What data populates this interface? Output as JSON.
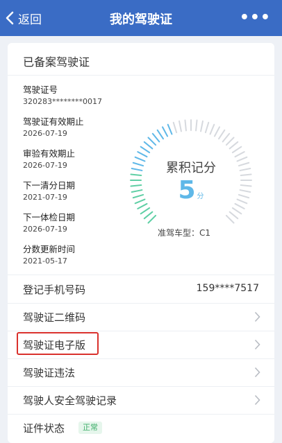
{
  "nav": {
    "back_label": "返回",
    "title": "我的驾驶证",
    "more_label": "•••"
  },
  "card": {
    "title": "已备案驾驶证"
  },
  "license_info": [
    {
      "label": "驾驶证号",
      "value": "320283********0017"
    },
    {
      "label": "驾驶证有效期止",
      "value": "2026-07-19"
    },
    {
      "label": "审验有效期止",
      "value": "2026-07-19"
    },
    {
      "label": "下一清分日期",
      "value": "2021-07-19"
    },
    {
      "label": "下一体检日期",
      "value": "2026-07-19"
    },
    {
      "label": "分数更新时间",
      "value": "2021-05-17"
    }
  ],
  "score": {
    "title": "累积记分",
    "value": "5",
    "unit": "分",
    "max": 12,
    "vehicle_type": "准驾车型：C1"
  },
  "rows": {
    "phone_label": "登记手机号码",
    "phone_value": "159****7517",
    "qr_label": "驾驶证二维码",
    "ecard_label": "驾驶证电子版",
    "violation_label": "驾驶证违法",
    "record_label": "驾驶人安全驾驶记录",
    "status_label": "证件状态",
    "status_value": "正常"
  },
  "colors": {
    "nav": "#3a6cc5",
    "accent": "#5fb8e8",
    "tick_filled": "#5fcfa5",
    "tick_empty": "#d6d9de",
    "highlight": "#d9302c",
    "status_green": "#3fae6a"
  }
}
